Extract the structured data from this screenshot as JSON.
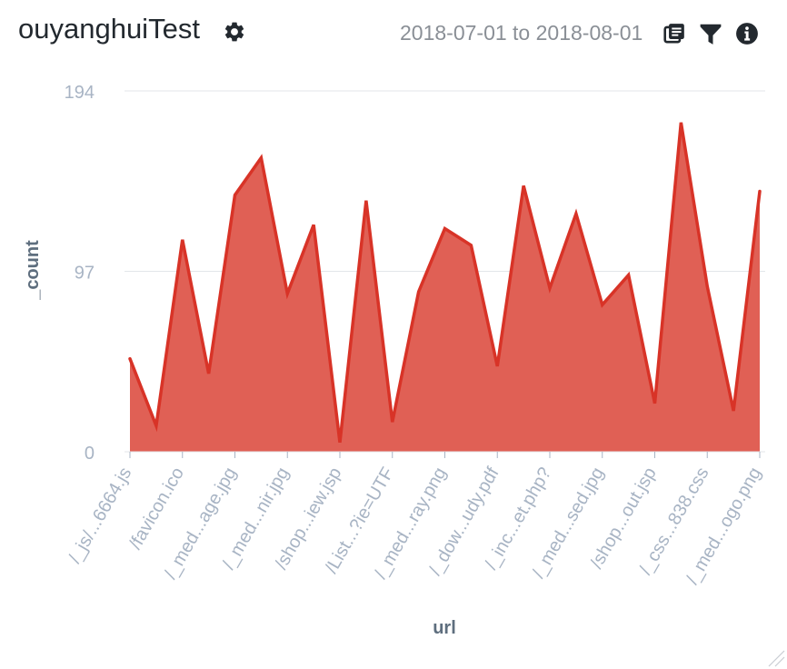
{
  "panel": {
    "title": "ouyanghuiTest",
    "date_from": "2018-07-01",
    "date_sep": "to",
    "date_to": "2018-08-01",
    "icons": [
      "gear-icon",
      "inspect-icon",
      "filter-icon",
      "info-icon"
    ]
  },
  "colors": {
    "series_line": "#d83327",
    "series_fill": "#e06055",
    "grid": "#e3e6ea",
    "tick_text": "#a8b4c4",
    "axis_title": "#5e6e7e"
  },
  "chart_data": {
    "type": "area",
    "xlabel": "url",
    "ylabel": "_count",
    "ylim": [
      0,
      194
    ],
    "yticks": [
      0,
      97,
      194
    ],
    "x_tick_labels": [
      "/_js/...6664.js",
      "/favicon.ico",
      "/_med...age.jpg",
      "/_med...nir.jpg",
      "/shop...iew.jsp",
      "/List...?ie=UTF",
      "/_med...ray.png",
      "/_dow...udy.pdf",
      "/_inc...et.php?",
      "/_med...sed.jpg",
      "/shop...out.jsp",
      "/_css...838.css",
      "/_med...ogo.png"
    ],
    "series": [
      {
        "values": [
          50,
          14,
          114,
          42,
          138,
          158,
          85,
          122,
          5,
          135,
          16,
          86,
          120,
          111,
          46,
          143,
          88,
          128,
          79,
          95,
          26,
          177,
          89,
          22,
          140
        ]
      }
    ],
    "grid": true
  }
}
